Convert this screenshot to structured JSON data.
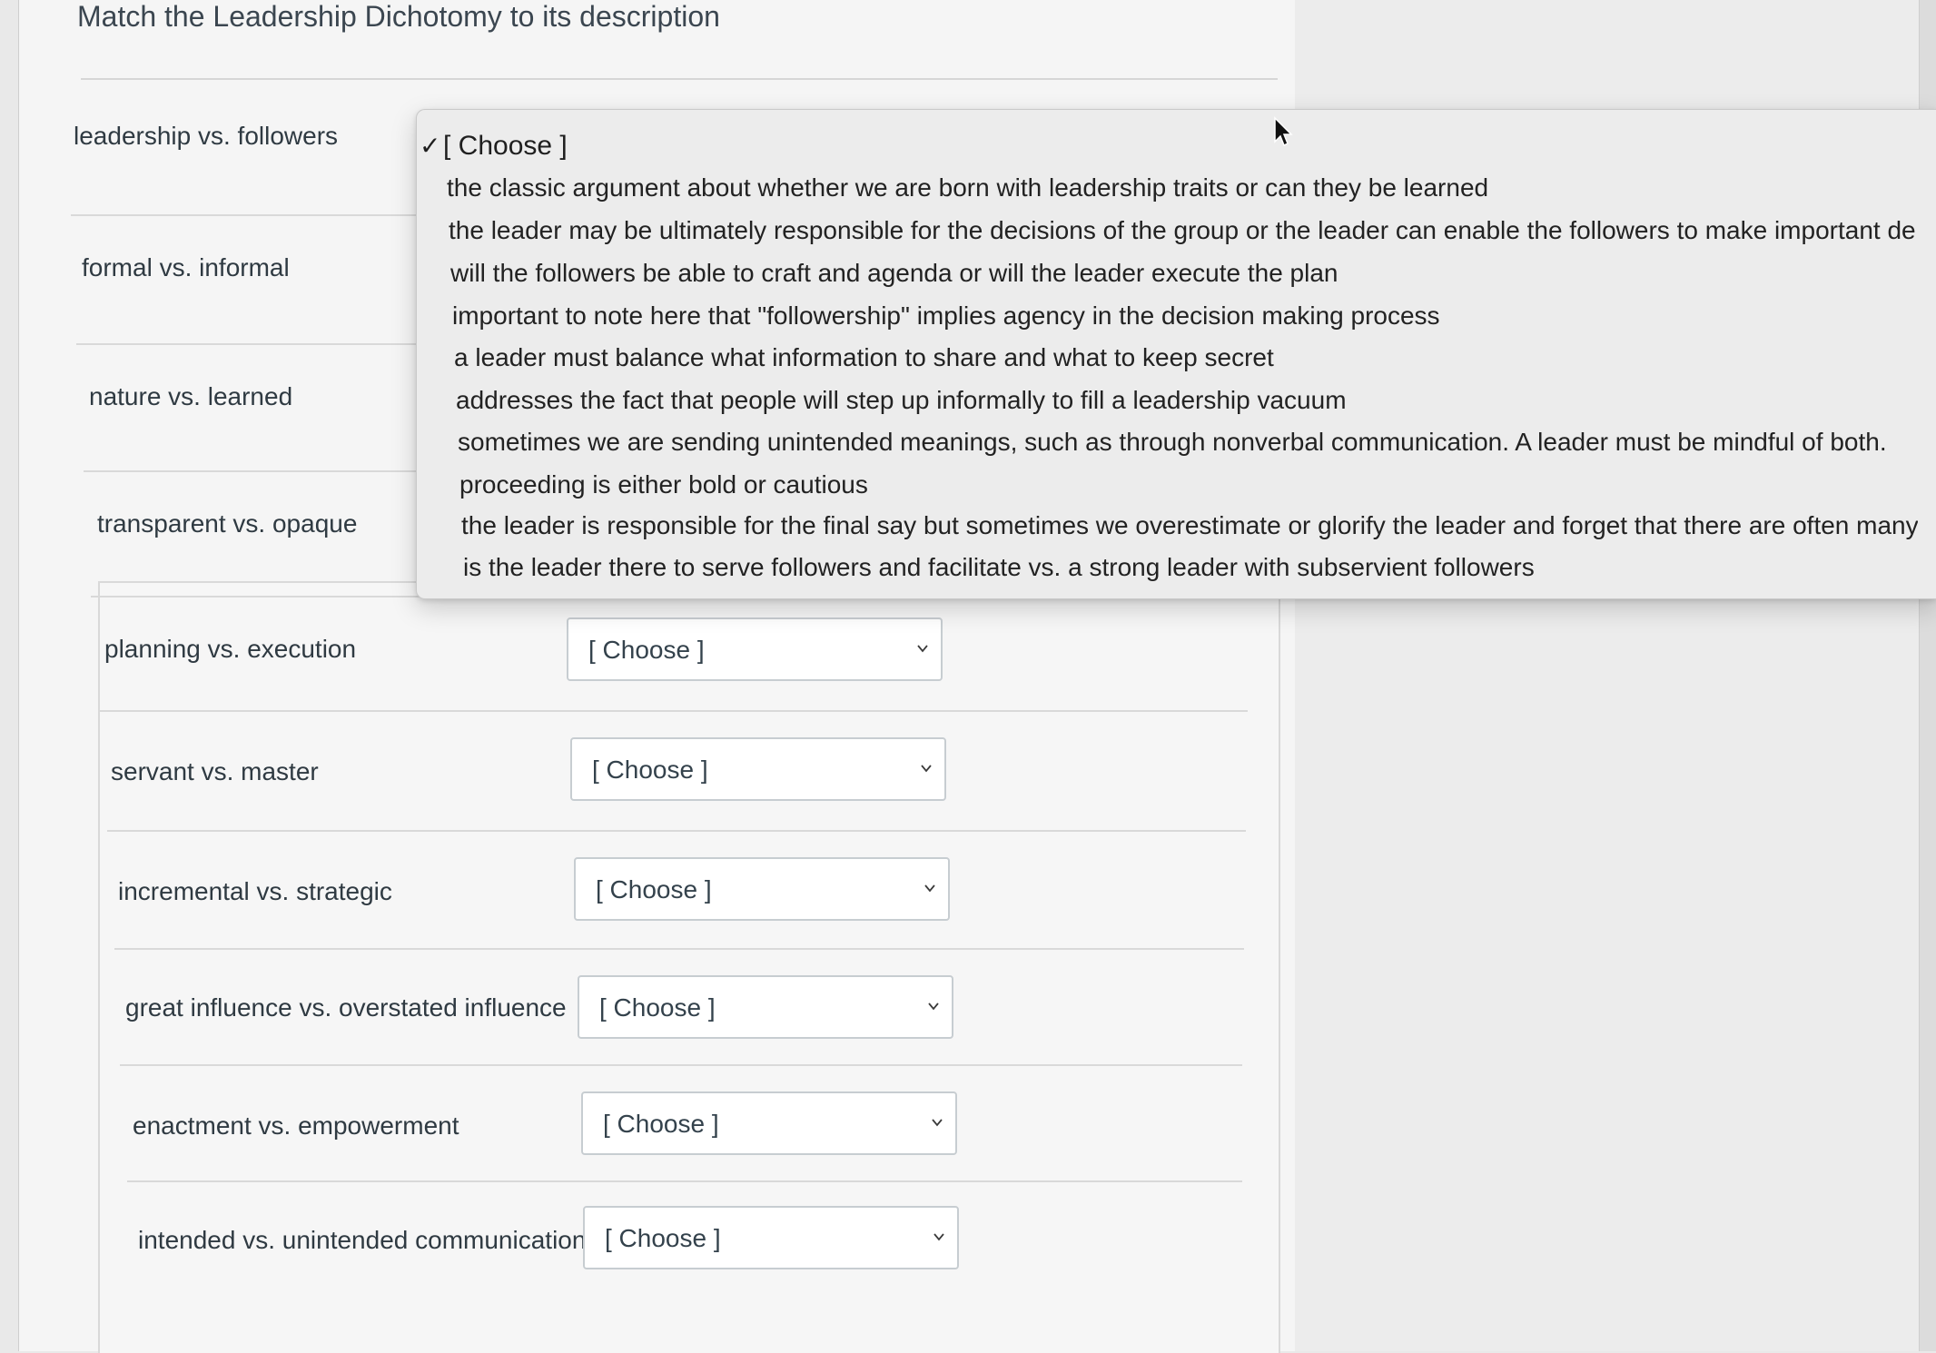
{
  "question": {
    "title": "Match the Leadership Dichotomy to its description"
  },
  "rows": [
    {
      "label": "leadership vs. followers",
      "selected": "[ Choose ]"
    },
    {
      "label": "formal vs. informal",
      "selected": "[ Choose ]"
    },
    {
      "label": "nature vs. learned",
      "selected": "[ Choose ]"
    },
    {
      "label": "transparent vs. opaque",
      "selected": "[ Choose ]"
    },
    {
      "label": "planning vs. execution",
      "selected": "[ Choose ]"
    },
    {
      "label": "servant vs. master",
      "selected": "[ Choose ]"
    },
    {
      "label": "incremental vs. strategic",
      "selected": "[ Choose ]"
    },
    {
      "label": "great influence vs. overstated influence",
      "selected": "[ Choose ]"
    },
    {
      "label": "enactment vs. empowerment",
      "selected": "[ Choose ]"
    },
    {
      "label": "intended vs. unintended communication",
      "selected": "[ Choose ]"
    }
  ],
  "dropdown": {
    "selected_option": "[ Choose ]",
    "check_glyph": "✓",
    "options": [
      "the classic argument about whether we are born with leadership traits or can they be learned",
      "the leader may be ultimately responsible for the decisions of the group or the leader can enable the followers to make important de...",
      "will the followers be able to craft and agenda or will the leader execute the plan",
      "important to note here that \"followership\" implies agency in the decision making process",
      "a leader must balance what information to share and what to keep secret",
      "addresses the fact that people will step up informally to fill a leadership vacuum",
      "sometimes we are sending unintended meanings, such as through nonverbal communication. A leader must be mindful of both.",
      "proceeding is either bold or cautious",
      "the leader is responsible for the final say but sometimes we overestimate or glorify the leader and forget that there are often many...",
      "is the leader there to serve followers and facilitate vs. a strong leader with subservient followers"
    ]
  },
  "colors": {
    "page_background": "#e9e9e9",
    "card_background": "#f5f5f5",
    "select_background": "#ffffff",
    "select_border": "#c7cdd1",
    "text": "#2f3a42"
  }
}
